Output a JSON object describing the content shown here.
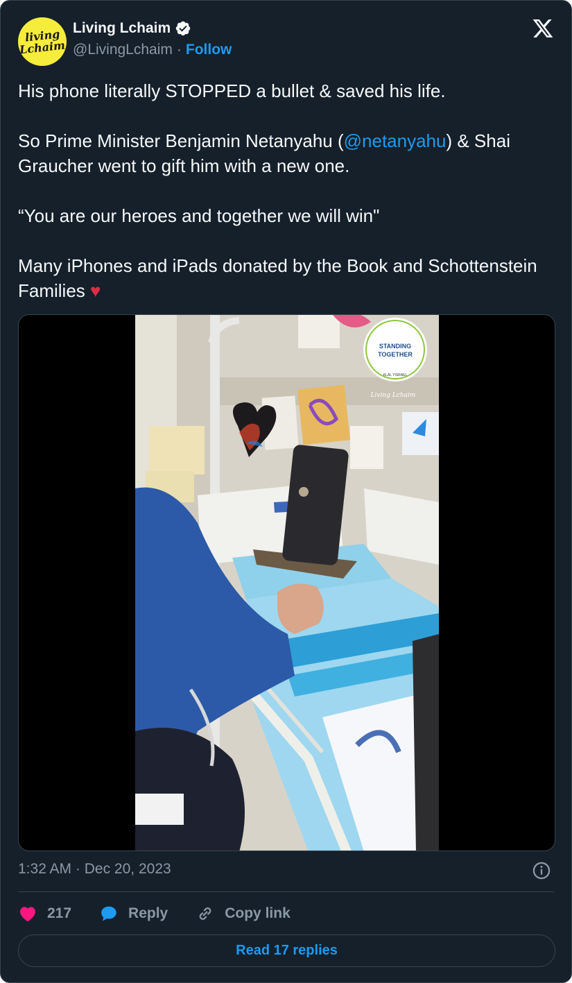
{
  "author": {
    "avatar_text_line1": "living",
    "avatar_text_line2": "Lchaim",
    "name": "Living Lchaim",
    "handle": "@LivingLchaim",
    "separator": "·",
    "follow_label": "Follow"
  },
  "tweet": {
    "line1": "His phone literally STOPPED a bullet & saved his life.",
    "p2_before": "So Prime Minister Benjamin Netanyahu (",
    "p2_mention": "@netanyahu",
    "p2_after": ") & Shai Graucher went to gift him with a new one.",
    "quote": "“You are our heroes and together we will win\"",
    "p4": "Many iPhones and iPads donated by the Book and Schottenstein Families",
    "emoji": "♥"
  },
  "media": {
    "logo_line1": "STANDING",
    "logo_line2": "TOGETHER",
    "logo_line3": "KLAL YISRAEL",
    "watermark": "Living Lchaim"
  },
  "meta": {
    "time": "1:32 AM",
    "separator": "·",
    "date": "Dec 20, 2023"
  },
  "actions": {
    "like_count": "217",
    "reply_label": "Reply",
    "copy_label": "Copy link"
  },
  "read_replies_label": "Read 17 replies",
  "colors": {
    "background": "#15202b",
    "accent": "#1d9bf0",
    "like": "#f91880",
    "muted": "#8b98a5"
  }
}
